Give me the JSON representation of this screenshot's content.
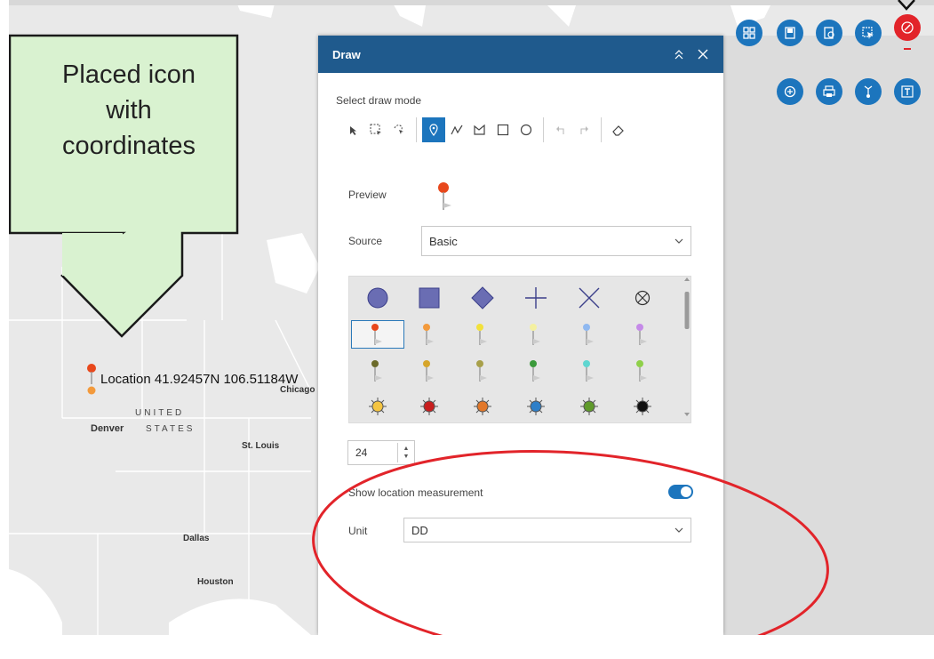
{
  "callout": {
    "text_line1": "Placed icon",
    "text_line2": "with",
    "text_line3": "coordinates"
  },
  "map": {
    "location_label": "Location 41.92457N 106.51184W",
    "places": {
      "chicago": "Chicago",
      "denver": "Denver",
      "united": "UNITED",
      "states": "STATES",
      "st_louis": "St. Louis",
      "dallas": "Dallas",
      "houston": "Houston"
    }
  },
  "widgets": [
    {
      "name": "basemap-gallery-icon"
    },
    {
      "name": "bookmark-icon"
    },
    {
      "name": "query-icon"
    },
    {
      "name": "select-icon"
    },
    {
      "name": "draw-icon",
      "active": true
    },
    {
      "name": "measure-icon"
    },
    {
      "name": "print-icon"
    },
    {
      "name": "share-icon"
    },
    {
      "name": "text-icon"
    }
  ],
  "panel": {
    "title": "Draw",
    "select_mode_label": "Select draw mode",
    "preview_label": "Preview",
    "source_label": "Source",
    "source_value": "Basic",
    "size_value": "24",
    "show_location_label": "Show location measurement",
    "show_location_on": true,
    "unit_label": "Unit",
    "unit_value": "DD"
  },
  "colors": {
    "header": "#1f5a8d",
    "accent": "#1c75bd",
    "callout_fill": "#d9f2d0",
    "annotation_red": "#e2242a"
  }
}
